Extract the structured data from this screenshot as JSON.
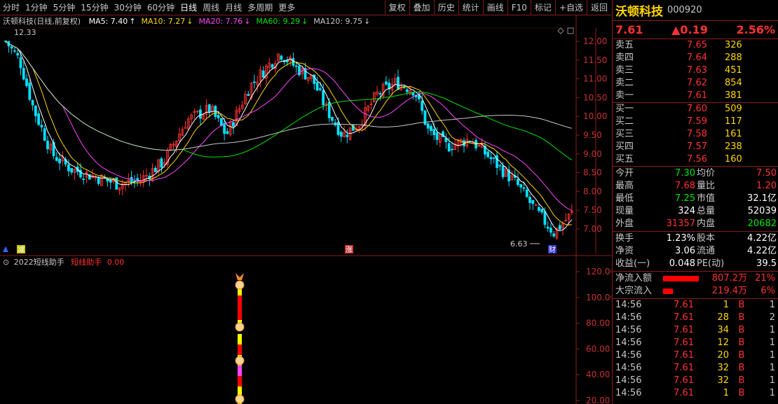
{
  "toolbar": {
    "periods": [
      "分时",
      "1分钟",
      "5分钟",
      "15分钟",
      "30分钟",
      "60分钟",
      "日线",
      "周线",
      "月线",
      "多周期",
      "更多"
    ],
    "active_period": "日线",
    "right_buttons": [
      "复权",
      "叠加",
      "历史",
      "统计",
      "画线",
      "F10",
      "标记",
      "+自选",
      "返回"
    ]
  },
  "chart": {
    "title": "沃顿科技(日线,前复权)",
    "ma": [
      {
        "label": "MA5: 7.40",
        "color": "#ffffff"
      },
      {
        "label": "MA10: 7.27",
        "color": "#ffd700"
      },
      {
        "label": "MA20: 7.76",
        "color": "#ff44ff"
      },
      {
        "label": "MA60: 9.29",
        "color": "#00e600"
      },
      {
        "label": "MA120: 9.75",
        "color": "#c8c8c8"
      }
    ],
    "high_label": "12.33",
    "low_label": "6.63",
    "y_ticks": [
      "12.00",
      "11.50",
      "11.00",
      "10.50",
      "10.00",
      "9.50",
      "9.00",
      "8.50",
      "8.00",
      "7.50",
      "7.00"
    ],
    "markers": [
      "减",
      "涨",
      "财"
    ],
    "colors": {
      "up": "#ff3232",
      "down": "#00e0ff",
      "ma5": "#ffffff",
      "ma10": "#ffd700",
      "ma20": "#ff44ff",
      "ma60": "#00e600",
      "ma120": "#c8c8c8",
      "border": "#8a1c1c"
    }
  },
  "sub": {
    "title": "2022短线助手",
    "label2": "短线助手",
    "value": "0.00",
    "y_ticks": [
      "120.00",
      "100.00",
      "80.00",
      "60.00",
      "40.00",
      "20.00"
    ]
  },
  "quote": {
    "name": "沃顿科技",
    "code": "000920",
    "price": "7.61",
    "change": "▲0.19",
    "pct": "2.56%"
  },
  "asks": [
    {
      "label": "卖五",
      "price": "7.65",
      "vol": "326"
    },
    {
      "label": "卖四",
      "price": "7.64",
      "vol": "288"
    },
    {
      "label": "卖三",
      "price": "7.63",
      "vol": "451"
    },
    {
      "label": "卖二",
      "price": "7.62",
      "vol": "854"
    },
    {
      "label": "卖一",
      "price": "7.61",
      "vol": "381"
    }
  ],
  "bids": [
    {
      "label": "买一",
      "price": "7.60",
      "vol": "509"
    },
    {
      "label": "买二",
      "price": "7.59",
      "vol": "117"
    },
    {
      "label": "买三",
      "price": "7.58",
      "vol": "161"
    },
    {
      "label": "买四",
      "price": "7.57",
      "vol": "238"
    },
    {
      "label": "买五",
      "price": "7.56",
      "vol": "160"
    }
  ],
  "stats": [
    {
      "l1": "今开",
      "v1": "7.30",
      "c1": "green",
      "l2": "均价",
      "v2": "7.50",
      "c2": "red"
    },
    {
      "l1": "最高",
      "v1": "7.68",
      "c1": "red",
      "l2": "量比",
      "v2": "1.20",
      "c2": "red"
    },
    {
      "l1": "最低",
      "v1": "7.25",
      "c1": "green",
      "l2": "市值",
      "v2": "32.1亿",
      "c2": "white"
    },
    {
      "l1": "现量",
      "v1": "324",
      "c1": "white",
      "l2": "总量",
      "v2": "52039",
      "c2": "white"
    },
    {
      "l1": "外盘",
      "v1": "31357",
      "c1": "red",
      "l2": "内盘",
      "v2": "20682",
      "c2": "green"
    }
  ],
  "stats2": [
    {
      "l1": "换手",
      "v1": "1.23%",
      "c1": "white",
      "l2": "股本",
      "v2": "4.22亿",
      "c2": "white"
    },
    {
      "l1": "净资",
      "v1": "3.06",
      "c1": "white",
      "l2": "流通",
      "v2": "4.22亿",
      "c2": "white"
    },
    {
      "l1": "收益(一)",
      "v1": "0.048",
      "c1": "white",
      "l2": "PE(动)",
      "v2": "39.5",
      "c2": "white"
    }
  ],
  "flows": [
    {
      "label": "净流入额",
      "value": "807.2万",
      "pct": "21%",
      "fill": 0.95
    },
    {
      "label": "大宗流入",
      "value": "219.4万",
      "pct": "6%",
      "fill": 0.25
    }
  ],
  "ticks": [
    {
      "time": "14:56",
      "price": "7.61",
      "vol": "1",
      "side": "B",
      "cnt": "1"
    },
    {
      "time": "14:56",
      "price": "7.61",
      "vol": "28",
      "side": "B",
      "cnt": "2"
    },
    {
      "time": "14:56",
      "price": "7.61",
      "vol": "34",
      "side": "B",
      "cnt": "1"
    },
    {
      "time": "14:56",
      "price": "7.61",
      "vol": "12",
      "side": "B",
      "cnt": "1"
    },
    {
      "time": "14:56",
      "price": "7.61",
      "vol": "20",
      "side": "B",
      "cnt": "1"
    },
    {
      "time": "14:56",
      "price": "7.61",
      "vol": "32",
      "side": "B",
      "cnt": "1"
    },
    {
      "time": "14:56",
      "price": "7.61",
      "vol": "32",
      "side": "B",
      "cnt": "1"
    },
    {
      "time": "14:56",
      "price": "7.61",
      "vol": "1",
      "side": "B",
      "cnt": "1"
    }
  ]
}
